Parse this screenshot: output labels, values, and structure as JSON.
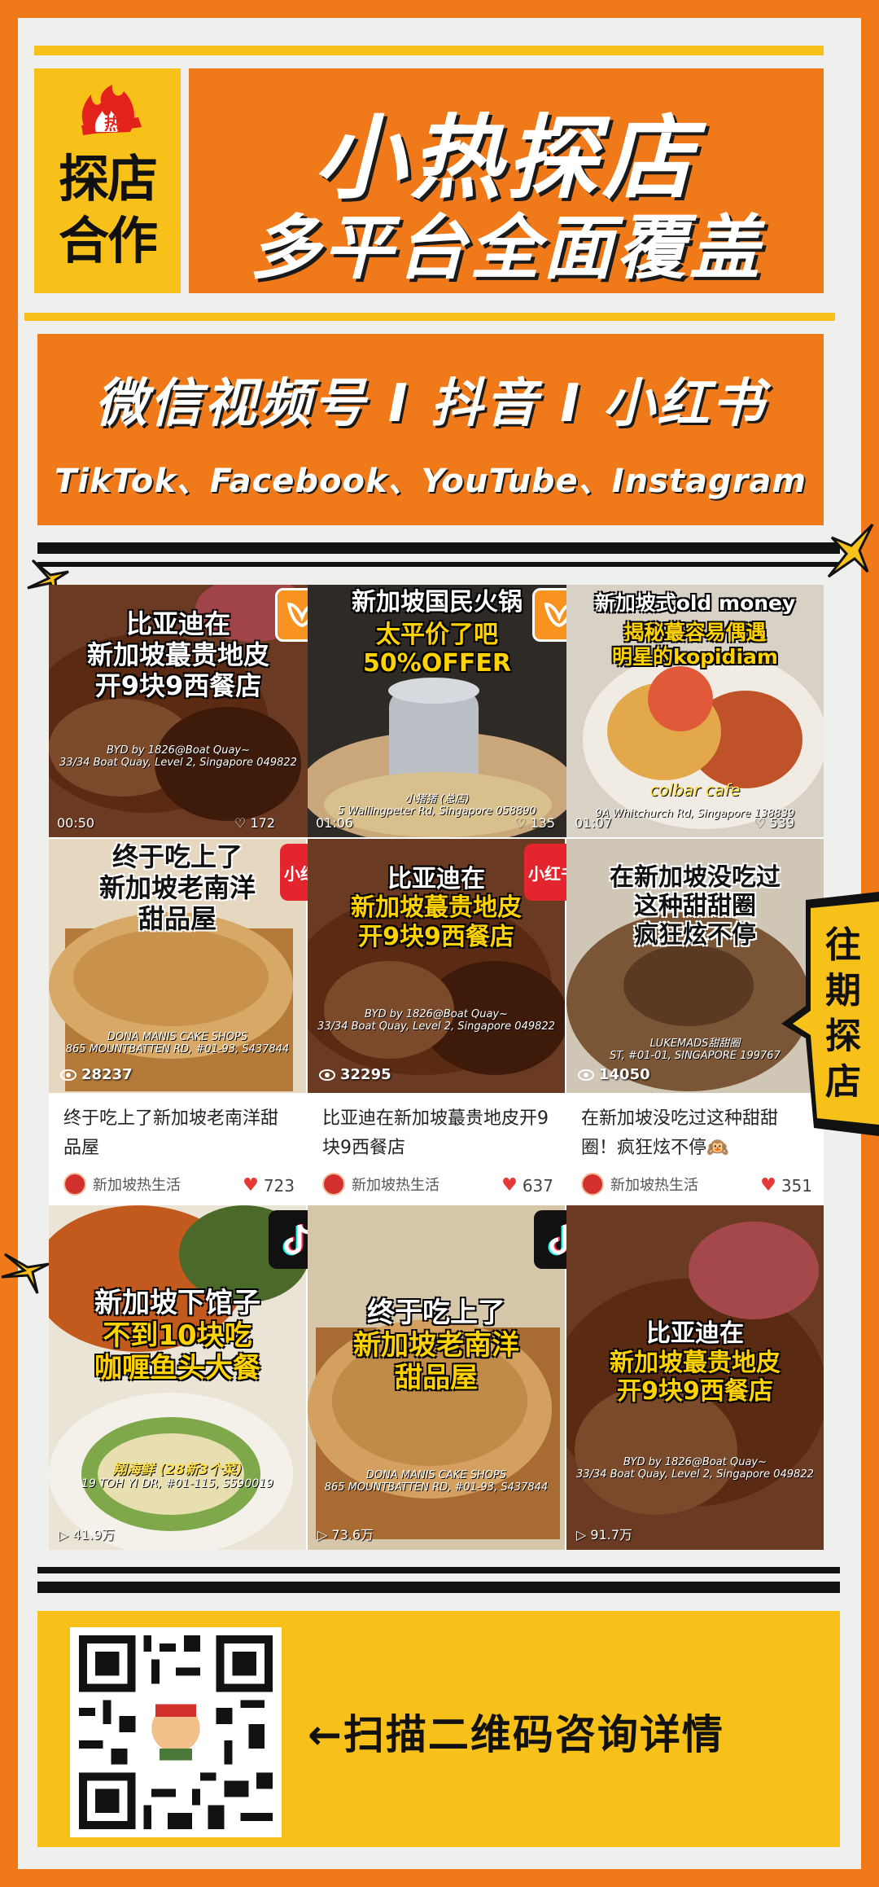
{
  "header": {
    "badge_icon": "fire-hot-icon",
    "badge_icon_text": "热",
    "badge_line1": "探店",
    "badge_line2": "合作",
    "title": "小热探店",
    "subtitle": "多平台全面覆盖"
  },
  "platforms": {
    "line1": "微信视频号 I 抖音 I 小红书",
    "line2": "TikTok、Facebook、YouTube、Instagram"
  },
  "colors": {
    "orange": "#f07a1a",
    "yellow": "#f7c11a",
    "light_bg": "#efefed",
    "red_heart": "#e53935",
    "xhs_red": "#e4252d"
  },
  "past_badge": "往期探店",
  "row1": [
    {
      "platform_icon": "wechat-channels-icon",
      "title_lines": [
        "比亚迪在",
        "新加坡蕞贵地皮",
        "开9块9西餐店"
      ],
      "address": "BYD by 1826@Boat Quay~\n33/34 Boat Quay, Level 2, Singapore 049822",
      "duration": "00:50",
      "likes": "172"
    },
    {
      "platform_icon": "wechat-channels-icon",
      "title_lines": [
        "新加坡国民火锅",
        "太平价了吧",
        "50%OFFER"
      ],
      "address": "小猪猪 (总店)\n5 Wallingpeter Rd, Singapore 058890",
      "duration": "01:06",
      "likes": "135"
    },
    {
      "platform_icon": "wechat-channels-icon",
      "title_lines": [
        "新加坡式old money",
        "揭秘蕞容易偶遇",
        "明星的kopidiam"
      ],
      "shop": "colbar cafe",
      "address": "9A Whitchurch Rd, Singapore 138839",
      "duration": "01:07",
      "likes": "539"
    }
  ],
  "row2": [
    {
      "platform_icon": "xiaohongshu-icon",
      "platform_label": "小红书",
      "title_lines": [
        "终于吃上了",
        "新加坡老南洋",
        "甜品屋"
      ],
      "address": "DONA MANIS CAKE SHOPS\n865 MOUNTBATTEN RD, #01-93, S437844",
      "views": "28237",
      "caption": "终于吃上了新加坡老南洋甜品屋",
      "account": "新加坡热生活",
      "likes": "723"
    },
    {
      "platform_icon": "xiaohongshu-icon",
      "platform_label": "小红书",
      "title_lines": [
        "比亚迪在",
        "新加坡蕞贵地皮",
        "开9块9西餐店"
      ],
      "address": "BYD by 1826@Boat Quay~\n33/34 Boat Quay, Level 2, Singapore 049822",
      "views": "32295",
      "caption": "比亚迪在新加坡蕞贵地皮开9块9西餐店",
      "account": "新加坡热生活",
      "likes": "637"
    },
    {
      "platform_icon": "xiaohongshu-icon",
      "title_lines": [
        "在新加坡没吃过",
        "这种甜甜圈",
        "疯狂炫不停"
      ],
      "address": "LUKEMADS甜甜圈\nST, #01-01, SINGAPORE 199767",
      "views": "14050",
      "caption": "在新加坡没吃过这种甜甜圈！疯狂炫不停🙉",
      "account": "新加坡热生活",
      "likes": "351"
    }
  ],
  "row3": [
    {
      "platform_icon": "tiktok-icon",
      "title_lines": [
        "新加坡下馆子",
        "不到10块吃",
        "咖喱鱼头大餐"
      ],
      "shop": "翔海鲜 (28新3个菜)",
      "address": "19 TOH YI DR, #01-115, S590019",
      "plays": "41.9万"
    },
    {
      "platform_icon": "tiktok-icon",
      "title_lines": [
        "终于吃上了",
        "新加坡老南洋",
        "甜品屋"
      ],
      "address": "DONA MANIS CAKE SHOPS\n865 MOUNTBATTEN RD, #01-93, S437844",
      "plays": "73.6万"
    },
    {
      "platform_icon": "tiktok-icon",
      "title_lines": [
        "比亚迪在",
        "新加坡蕞贵地皮",
        "开9块9西餐店"
      ],
      "address": "BYD by 1826@Boat Quay~\n33/34 Boat Quay, Level 2, Singapore 049822",
      "plays": "91.7万"
    }
  ],
  "qr": {
    "icon": "qr-code-icon",
    "text": "←扫描二维码咨询详情"
  }
}
